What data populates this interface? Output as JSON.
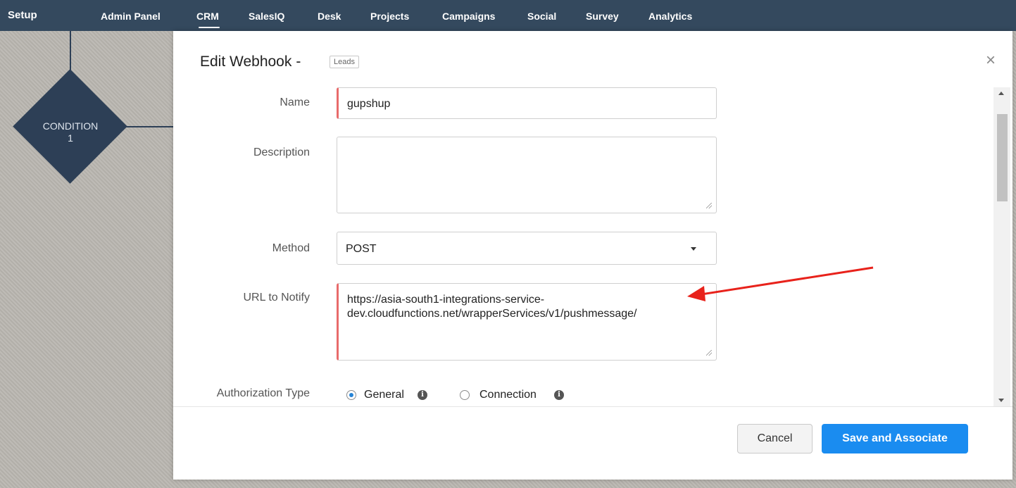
{
  "topnav": {
    "setup": "Setup",
    "items": [
      "Admin Panel",
      "CRM",
      "SalesIQ",
      "Desk",
      "Projects",
      "Campaigns",
      "Social",
      "Survey",
      "Analytics"
    ],
    "active": "CRM"
  },
  "diagram": {
    "condition_label": "CONDITION",
    "condition_number": "1"
  },
  "modal": {
    "title": "Edit Webhook",
    "title_dash": "-",
    "module_badge": "Leads",
    "close": "×",
    "fields": {
      "name_label": "Name",
      "name_value": "gupshup",
      "description_label": "Description",
      "description_value": "",
      "method_label": "Method",
      "method_value": "POST",
      "url_label": "URL to Notify",
      "url_line1": "https://asia-south1-integrations-service-",
      "url_line2": "dev.cloudfunctions.net/wrapperServices/v1/pushmessage/",
      "auth_label": "Authorization Type",
      "auth_general": "General",
      "auth_connection": "Connection",
      "auth_selected": "General"
    },
    "buttons": {
      "cancel": "Cancel",
      "save": "Save and Associate"
    }
  },
  "colors": {
    "nav_bg": "#34495e",
    "diagram": "#2d3f56",
    "primary_button": "#1a8cf0",
    "required_marker": "#e86b6b",
    "annotation_arrow": "#e8221b"
  },
  "icons": [
    "close-icon",
    "chevron-down-icon",
    "info-icon",
    "resize-grip-icon",
    "annotation-arrow"
  ]
}
